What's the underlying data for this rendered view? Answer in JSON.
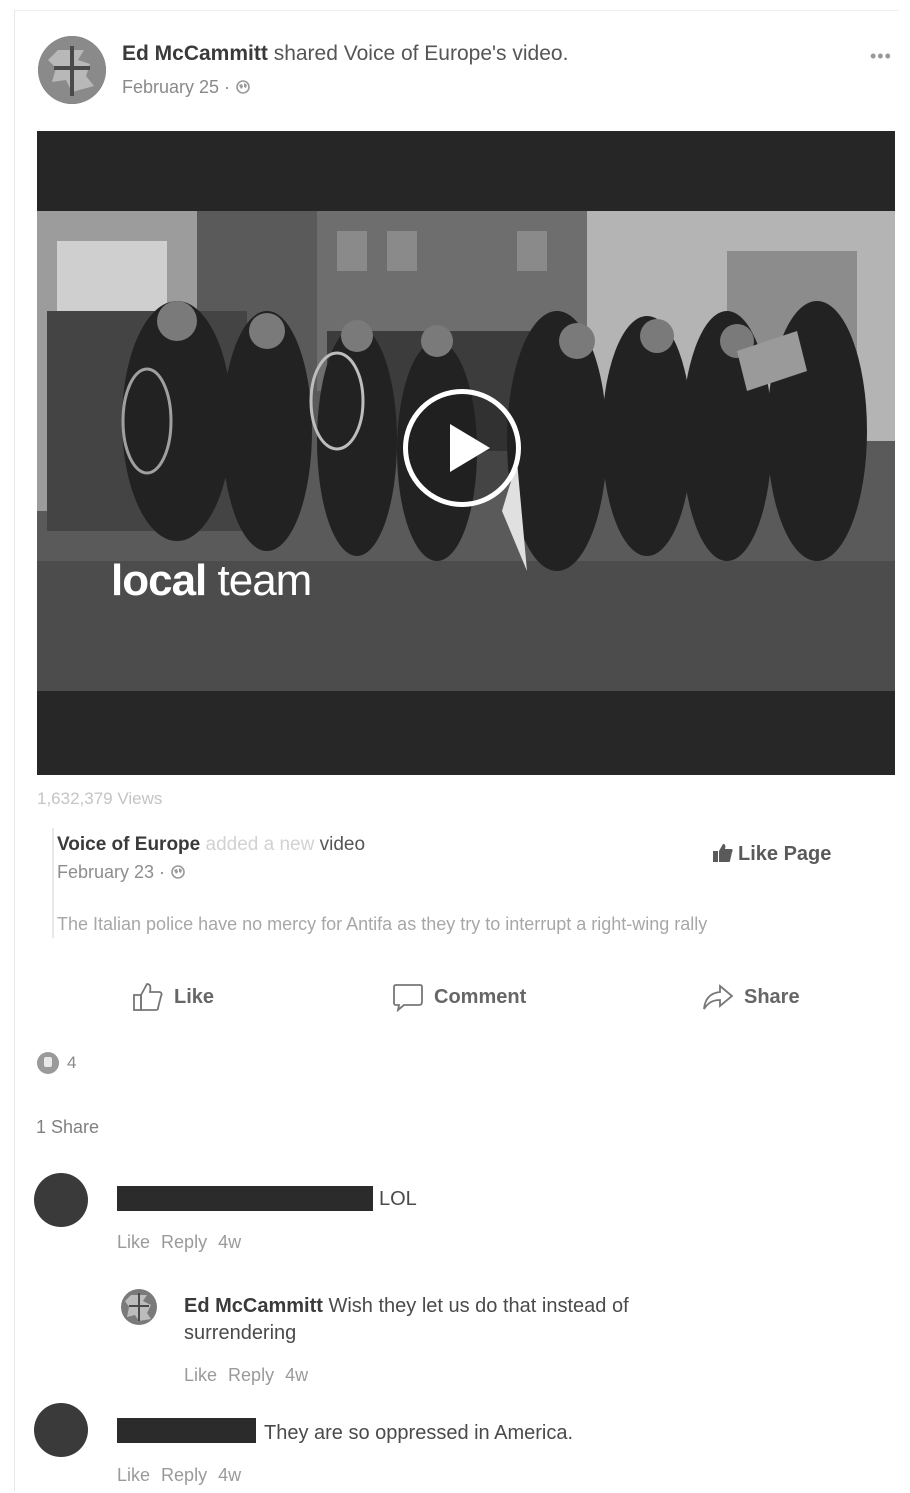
{
  "post": {
    "author": "Ed McCammitt",
    "action_text": "shared Voice of Europe's video.",
    "date": "February 25 ·",
    "more_icon": "ellipsis-icon"
  },
  "video": {
    "watermark_bold": "local",
    "watermark_light": " team",
    "views": "1,632,379 Views"
  },
  "shared_post": {
    "page_name": "Voice of Europe",
    "faint_text": " added a new",
    "action_tail": " video",
    "date": "February 23 ·",
    "like_page_label": "Like Page",
    "caption": "The Italian police have no mercy for Antifa as they try to interrupt a right-wing rally"
  },
  "actions": {
    "like": "Like",
    "comment": "Comment",
    "share": "Share"
  },
  "stats": {
    "reaction_count": "4",
    "shares": "1 Share"
  },
  "comments": [
    {
      "text": "LOL",
      "like": "Like",
      "reply": "Reply",
      "time": "4w",
      "replies": [
        {
          "author": "Ed McCammitt",
          "text": " Wish they let us do that instead of surrendering",
          "like": "Like",
          "reply": "Reply",
          "time": "4w"
        }
      ]
    },
    {
      "text": "They are so oppressed in America.",
      "like": "Like",
      "reply": "Reply",
      "time": "4w"
    }
  ]
}
